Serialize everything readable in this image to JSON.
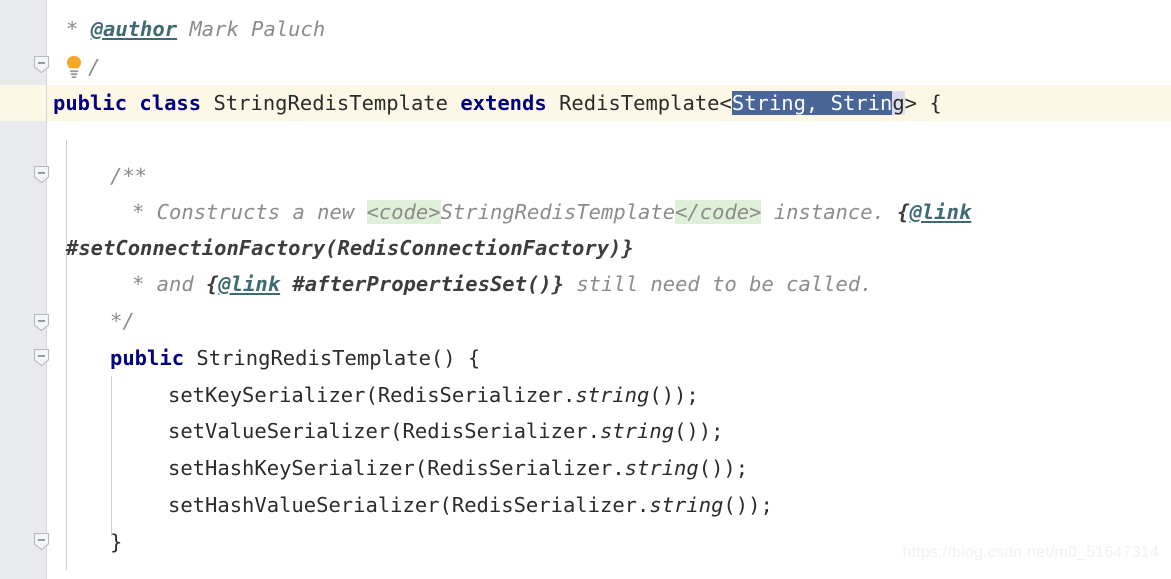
{
  "editor": {
    "language": "java",
    "background_color": "#ffffff",
    "gutter_color": "#e9eaec",
    "caret_line_color": "#fdf8e6",
    "keyword_color": "#000080",
    "comment_color": "#8c8c8c",
    "doctag_color": "#3d6a73",
    "selection_color": "#4a6598",
    "code_tag_highlight_color": "#dff0d8"
  },
  "intention": {
    "icon": "lightbulb-icon",
    "color": "#f5a623"
  },
  "gutter": {
    "fold_markers": [
      {
        "name": "fold-marker-javadoc-class",
        "glyph": "minus",
        "shape": "tag"
      },
      {
        "name": "fold-marker-javadoc-ctor",
        "glyph": "minus",
        "shape": "tag"
      },
      {
        "name": "fold-marker-ctor-header",
        "glyph": "minus",
        "shape": "tag"
      },
      {
        "name": "fold-marker-ctor-body",
        "glyph": "minus",
        "shape": "tag"
      },
      {
        "name": "fold-marker-next-member",
        "glyph": "minus",
        "shape": "tag"
      }
    ]
  },
  "lines": {
    "l1_author_star": "*",
    "l1_author_tag": "@author",
    "l1_author_name": "Mark Paluch",
    "l2_slash": "/",
    "l3_public": "public",
    "l3_class": "class",
    "l3_classname": "StringRedisTemplate",
    "l3_extends": "extends",
    "l3_super": "RedisTemplate",
    "l3_lt": "<",
    "l3_sel_main": "String, Strin",
    "l3_sel_tail": "g",
    "l3_gt_brace": "> {",
    "l5_open": "/**",
    "l6_star": "*",
    "l6_text1": " Constructs a new ",
    "l6_codeopen": "<code>",
    "l6_classname": "StringRedisTemplate",
    "l6_codeclose": "</code>",
    "l6_text2": " instance. ",
    "l6_brace": "{",
    "l6_link": "@link",
    "l7_wrapped": "#setConnectionFactory(RedisConnectionFactory)}",
    "l8_star": "*",
    "l8_and": " and ",
    "l8_brace": "{",
    "l8_link": "@link",
    "l8_ref": " #afterPropertiesSet()}",
    "l8_tail": " still need to be called.",
    "l9_close": "*/",
    "l10_public": "public",
    "l10_ctor": "StringRedisTemplate() {",
    "l11_call": "setKeySerializer",
    "l11_paren": "(",
    "l11_class": "RedisSerializer",
    "l11_dot": ".",
    "l11_method": "string",
    "l11_tail": "());",
    "l12_call": "setValueSerializer",
    "l13_call": "setHashKeySerializer",
    "l14_call": "setHashValueSerializer",
    "l15_close": "}"
  },
  "watermark": {
    "text": "https://blog.csdn.net/m0_51647314"
  }
}
